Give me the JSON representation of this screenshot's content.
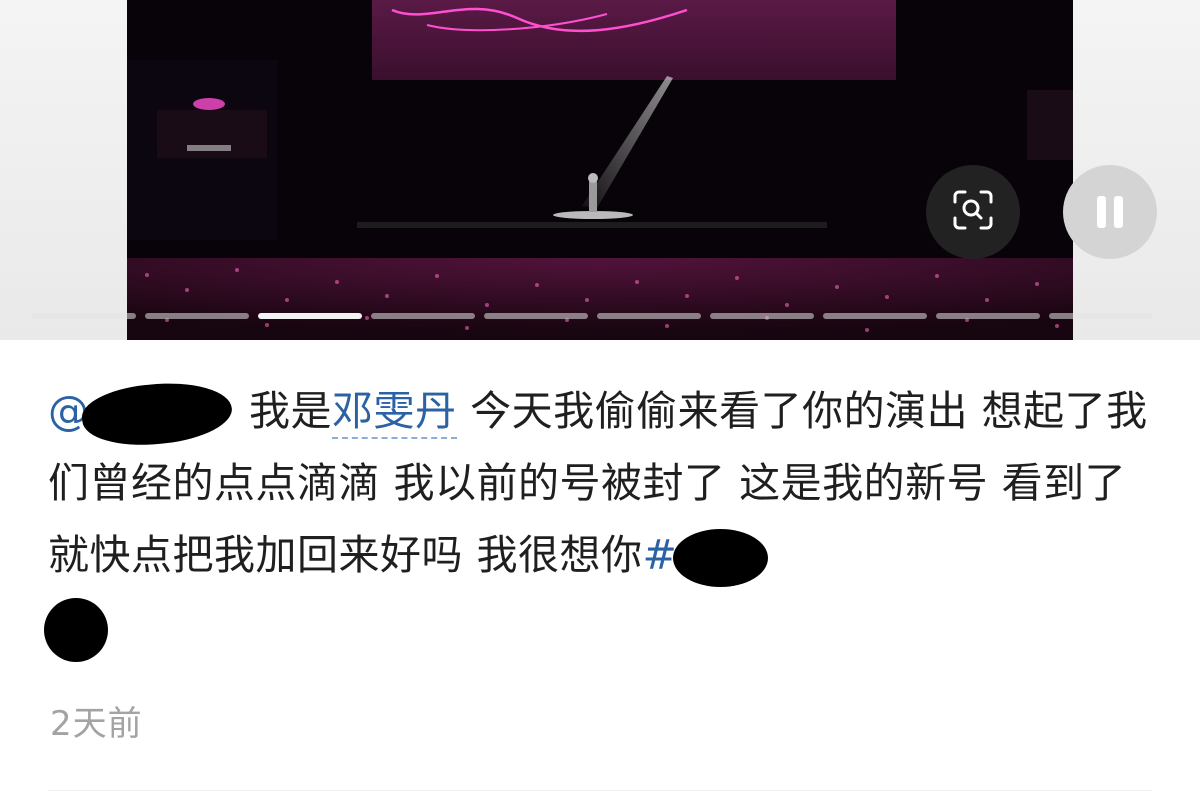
{
  "caption": {
    "mention_prefix": "@",
    "intro": "我是",
    "name": "邓雯丹",
    "body": "今天我偷偷来看了你的演出 想起了我们曾经的点点滴滴 我以前的号被封了 这是我的新号 看到了就快点把我加回来好吗 我很想你",
    "topic_prefix": "#"
  },
  "timestamp": "2天前",
  "media": {
    "page_count": 10,
    "active_index": 2,
    "scan_icon": "image-search-icon",
    "pause_icon": "pause-icon"
  }
}
